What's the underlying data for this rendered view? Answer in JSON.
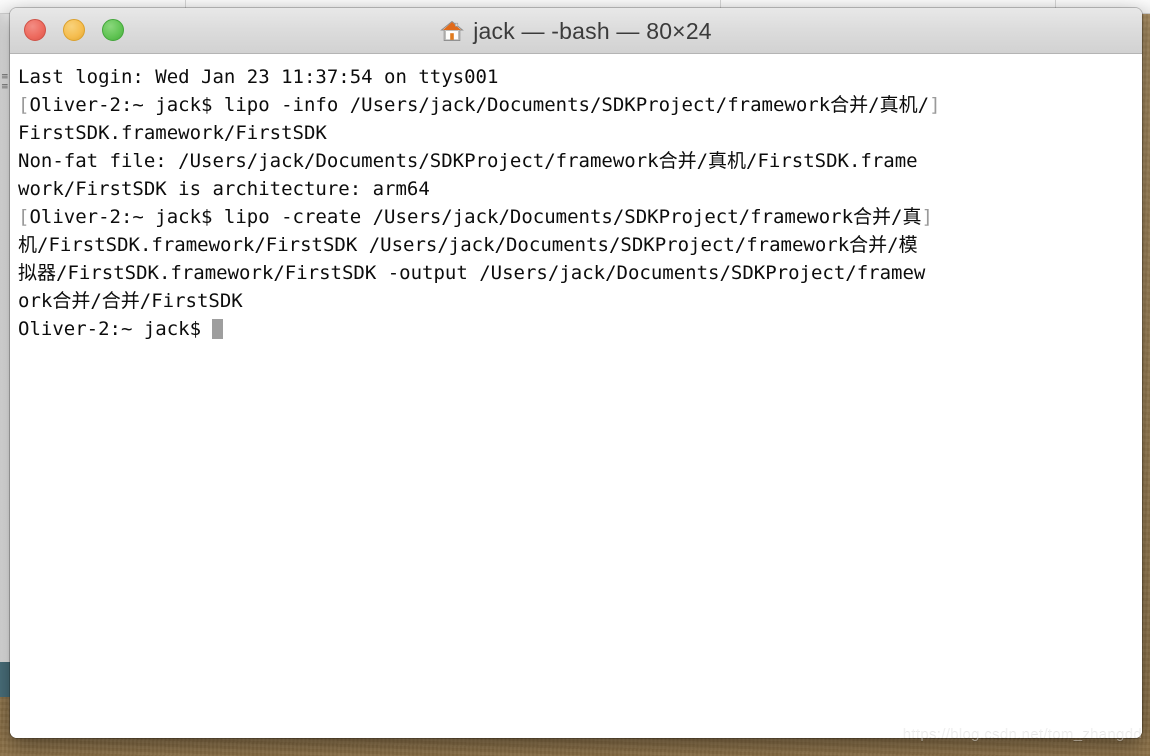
{
  "window": {
    "title": "jack — -bash — 80×24",
    "icon": "home-icon",
    "controls": {
      "close_label": "Close",
      "minimize_label": "Minimize",
      "zoom_label": "Zoom"
    },
    "colors": {
      "close": "#ED6A5E",
      "minimize": "#F5BD4F",
      "zoom": "#61C454",
      "titlebar": "#DCDCDC",
      "terminal_bg": "#FFFFFF",
      "terminal_fg": "#0C0C0C",
      "cursor": "#9E9E9E",
      "bracket": "#9A9A9A",
      "desktop": "#9D8155"
    }
  },
  "terminal": {
    "lines": [
      {
        "prefix": "",
        "text": "Last login: Wed Jan 23 11:37:54 on ttys001",
        "suffix": "",
        "cursor": false
      },
      {
        "prefix": "[",
        "text": "Oliver-2:~ jack$ lipo -info /Users/jack/Documents/SDKProject/framework合并/真机/",
        "suffix": "]",
        "cursor": false
      },
      {
        "prefix": "",
        "text": "FirstSDK.framework/FirstSDK",
        "suffix": "",
        "cursor": false
      },
      {
        "prefix": "",
        "text": "Non-fat file: /Users/jack/Documents/SDKProject/framework合并/真机/FirstSDK.frame",
        "suffix": "",
        "cursor": false
      },
      {
        "prefix": "",
        "text": "work/FirstSDK is architecture: arm64",
        "suffix": "",
        "cursor": false
      },
      {
        "prefix": "[",
        "text": "Oliver-2:~ jack$ lipo -create /Users/jack/Documents/SDKProject/framework合并/真",
        "suffix": "]",
        "cursor": false
      },
      {
        "prefix": "",
        "text": "机/FirstSDK.framework/FirstSDK /Users/jack/Documents/SDKProject/framework合并/模",
        "suffix": "",
        "cursor": false
      },
      {
        "prefix": "",
        "text": "拟器/FirstSDK.framework/FirstSDK -output /Users/jack/Documents/SDKProject/framew",
        "suffix": "",
        "cursor": false
      },
      {
        "prefix": "",
        "text": "ork合并/合并/FirstSDK",
        "suffix": "",
        "cursor": false
      },
      {
        "prefix": "",
        "text": "Oliver-2:~ jack$ ",
        "suffix": "",
        "cursor": true
      }
    ]
  },
  "background": {
    "left_window_marks": "≡\n≡",
    "divider_positions": [
      185,
      720,
      1055
    ]
  },
  "watermark": {
    "text": "https://blog.csdn.net/tom_zhangdd"
  }
}
